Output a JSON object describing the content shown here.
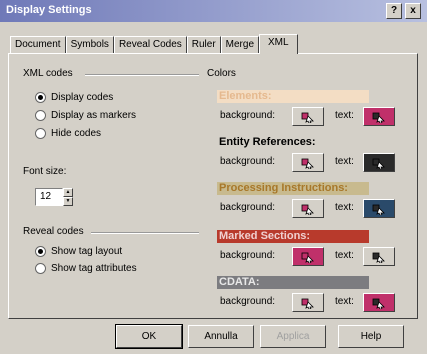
{
  "window": {
    "title": "Display Settings",
    "help_glyph": "?",
    "close_glyph": "x"
  },
  "tabs": [
    "Document",
    "Symbols",
    "Reveal Codes",
    "Ruler",
    "Merge",
    "XML"
  ],
  "active_tab": "XML",
  "xml_codes": {
    "label": "XML codes",
    "options": [
      "Display codes",
      "Display as markers",
      "Hide codes"
    ],
    "selected": "Display codes"
  },
  "font_size": {
    "label": "Font size:",
    "value": "12"
  },
  "reveal_codes": {
    "label": "Reveal codes",
    "options": [
      "Show tag layout",
      "Show tag attributes"
    ],
    "selected": "Show tag layout"
  },
  "colors": {
    "label": "Colors",
    "background_label": "background:",
    "text_label": "text:",
    "categories": [
      {
        "name": "Elements:",
        "header_bg": "#f3ddc4",
        "header_fg": "#e5b98f",
        "bg_icon": "#d4d0c8",
        "text_icon": "#c0306a"
      },
      {
        "name": "Entity References:",
        "header_bg": "#d4d0c8",
        "header_fg": "#000000",
        "bg_icon": "#d4d0c8",
        "text_icon": "#2a2a2a"
      },
      {
        "name": "Processing Instructions:",
        "header_bg": "#c8ba8e",
        "header_fg": "#a8782a",
        "bg_icon": "#d4d0c8",
        "text_icon": "#2a4a6a"
      },
      {
        "name": "Marked Sections:",
        "header_bg": "#b83a2c",
        "header_fg": "#f0d0d0",
        "bg_icon": "#c0306a",
        "text_icon": "#d4d0c8"
      },
      {
        "name": "CDATA:",
        "header_bg": "#7c7c80",
        "header_fg": "#e8e8e8",
        "bg_icon": "#d4d0c8",
        "text_icon": "#c0306a"
      }
    ]
  },
  "buttons": {
    "ok": "OK",
    "cancel": "Annulla",
    "apply": "Applica",
    "help": "Help"
  }
}
